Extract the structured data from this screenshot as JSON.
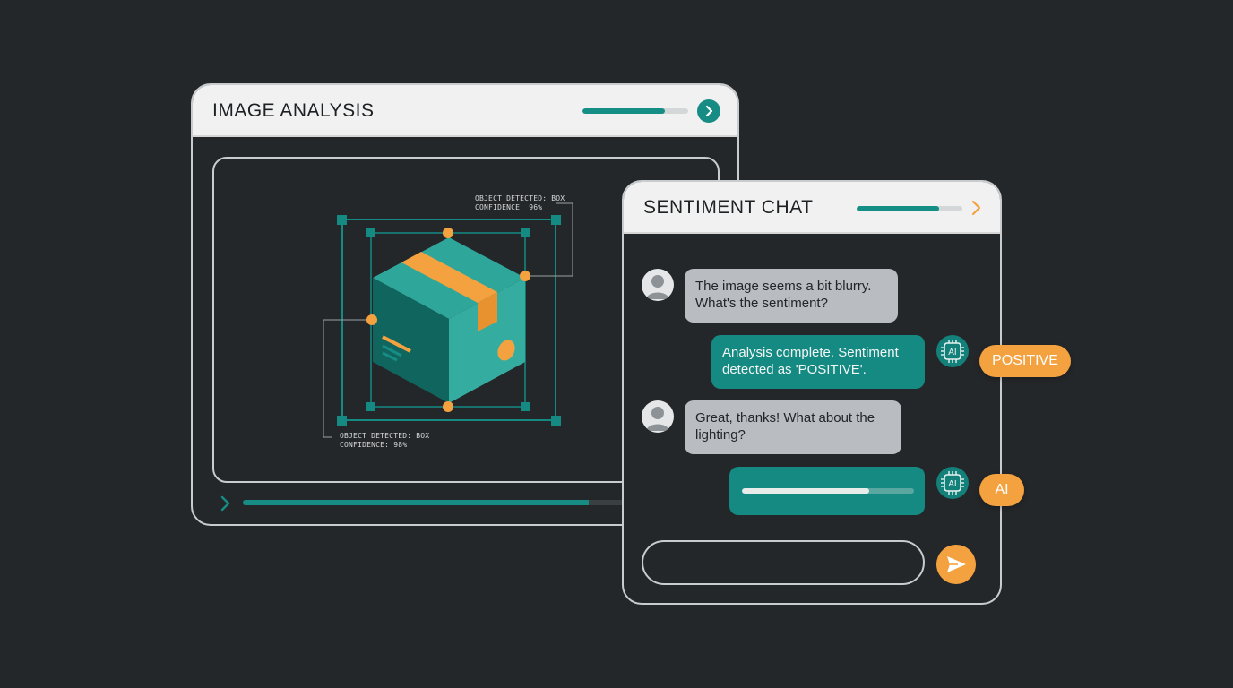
{
  "analysis": {
    "title": "IMAGE ANALYSIS",
    "header_progress": 0.78,
    "scan_progress": 0.69,
    "detection_top": {
      "line1": "OBJECT DETECTED: BOX",
      "line2": "CONFIDENCE: 96%"
    },
    "detection_bottom": {
      "line1": "OBJECT DETECTED: BOX",
      "line2": "CONFIDENCE: 98%"
    },
    "icons": {
      "next": "chevron-right-icon",
      "scan": "chevron-right-icon",
      "object": "box-icon"
    }
  },
  "chat": {
    "title": "SENTIMENT CHAT",
    "header_progress": 0.78,
    "messages": [
      {
        "role": "user",
        "text": "The image seems a bit blurry. What's the sentiment?"
      },
      {
        "role": "ai",
        "text": "Analysis complete. Sentiment detected as 'POSITIVE'.",
        "tag": "POSITIVE"
      },
      {
        "role": "user",
        "text": "Great, thanks! What about the lighting?"
      },
      {
        "role": "ai",
        "typing_progress": 0.74,
        "tag": "AI"
      }
    ],
    "ai_icon_label": "AI",
    "input_placeholder": "",
    "icons": {
      "avatar": "user-avatar-icon",
      "ai": "ai-chip-icon",
      "send": "send-icon",
      "header": "chevron-right-icon"
    }
  },
  "colors": {
    "background": "#24272a",
    "teal": "#148a82",
    "orange": "#f4a13f",
    "user_bubble": "#b9bcc1",
    "header": "#f1f1f1"
  }
}
